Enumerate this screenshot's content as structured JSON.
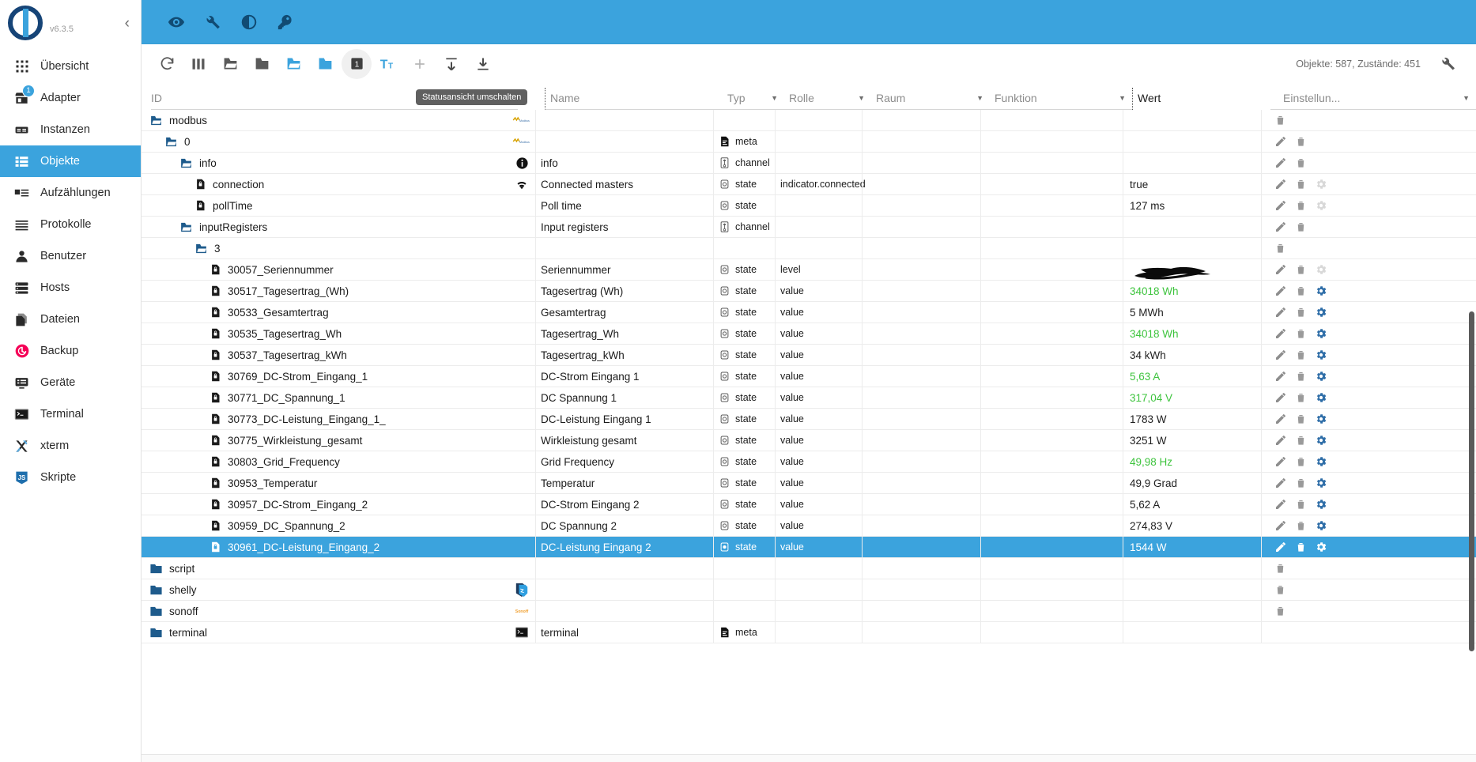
{
  "sidebar": {
    "version": "v6.3.5",
    "collapse_label": "‹",
    "items": [
      {
        "label": "Übersicht",
        "icon": "grid-icon",
        "active": false,
        "badge": null
      },
      {
        "label": "Adapter",
        "icon": "store-icon",
        "active": false,
        "badge": "1"
      },
      {
        "label": "Instanzen",
        "icon": "instances-icon",
        "active": false,
        "badge": null
      },
      {
        "label": "Objekte",
        "icon": "list-icon",
        "active": true,
        "badge": null
      },
      {
        "label": "Aufzählungen",
        "icon": "enums-icon",
        "active": false,
        "badge": null
      },
      {
        "label": "Protokolle",
        "icon": "logs-icon",
        "active": false,
        "badge": null
      },
      {
        "label": "Benutzer",
        "icon": "user-icon",
        "active": false,
        "badge": null
      },
      {
        "label": "Hosts",
        "icon": "hosts-icon",
        "active": false,
        "badge": null
      },
      {
        "label": "Dateien",
        "icon": "files-icon",
        "active": false,
        "badge": null
      },
      {
        "label": "Backup",
        "icon": "backup-icon",
        "active": false,
        "badge": null
      },
      {
        "label": "Geräte",
        "icon": "devices-icon",
        "active": false,
        "badge": null
      },
      {
        "label": "Terminal",
        "icon": "terminal-icon",
        "active": false,
        "badge": null
      },
      {
        "label": "xterm",
        "icon": "xterm-icon",
        "active": false,
        "badge": null
      },
      {
        "label": "Skripte",
        "icon": "javascript-icon",
        "active": false,
        "badge": null
      }
    ]
  },
  "appbar": {
    "buttons": [
      {
        "name": "eye-icon",
        "title": "Expertenmodus"
      },
      {
        "name": "wrench-icon",
        "title": "Konfiguration"
      },
      {
        "name": "contrast-icon",
        "title": "Theme"
      },
      {
        "name": "key-icon",
        "title": "Abmelden"
      }
    ]
  },
  "toolbar": {
    "buttons": [
      {
        "name": "refresh-icon"
      },
      {
        "name": "columns-icon"
      },
      {
        "name": "folder-expand-all-icon"
      },
      {
        "name": "folder-collapse-all-icon"
      },
      {
        "name": "folder-expand-icon"
      },
      {
        "name": "folder-collapse-icon"
      },
      {
        "name": "status-view-icon",
        "label": "1",
        "selected": true
      },
      {
        "name": "text-size-icon"
      },
      {
        "name": "add-icon"
      },
      {
        "name": "import-icon"
      },
      {
        "name": "export-icon"
      }
    ],
    "tooltip": "Statusansicht umschalten",
    "objects_count": "Objekte: 587, Zustände: 451",
    "settings_icon": "wrench-icon"
  },
  "table": {
    "columns": [
      {
        "key": "id",
        "label": "ID",
        "filter": false
      },
      {
        "key": "name",
        "label": "Name",
        "filter": false
      },
      {
        "key": "typ",
        "label": "Typ",
        "filter": true
      },
      {
        "key": "rolle",
        "label": "Rolle",
        "filter": true
      },
      {
        "key": "raum",
        "label": "Raum",
        "filter": true
      },
      {
        "key": "funktion",
        "label": "Funktion",
        "filter": true
      },
      {
        "key": "wert",
        "label": "Wert",
        "filter": false
      },
      {
        "key": "einstellungen",
        "label": "Einstellun...",
        "filter": true
      }
    ],
    "rows": [
      {
        "id": "modbus",
        "depth": 0,
        "icon": "folder-open-icon",
        "rowicon": "modbus-logo-icon",
        "name": "",
        "typ": "",
        "rolle": "",
        "wert": "",
        "value_color": "plain",
        "actions": [
          "delete"
        ],
        "selected": false
      },
      {
        "id": "0",
        "depth": 1,
        "icon": "folder-open-icon",
        "rowicon": "modbus-logo-icon",
        "name": "",
        "typ": "meta",
        "typicon": "meta-icon",
        "rolle": "",
        "wert": "",
        "value_color": "plain",
        "actions": [
          "edit",
          "delete"
        ],
        "selected": false
      },
      {
        "id": "info",
        "depth": 2,
        "icon": "folder-open-icon",
        "rowicon": "info-icon",
        "name": "info",
        "typ": "channel",
        "typicon": "channel-icon",
        "rolle": "",
        "wert": "",
        "value_color": "plain",
        "actions": [
          "edit",
          "delete"
        ],
        "selected": false
      },
      {
        "id": "connection",
        "depth": 3,
        "icon": "state-doc-icon",
        "rowicon": "wifi-icon",
        "name": "Connected masters",
        "typ": "state",
        "typicon": "state-icon",
        "rolle": "indicator.connected",
        "wert": "true",
        "value_color": "plain",
        "actions": [
          "edit",
          "delete",
          "settings-dim"
        ],
        "selected": false
      },
      {
        "id": "pollTime",
        "depth": 3,
        "icon": "state-doc-icon",
        "rowicon": "",
        "name": "Poll time",
        "typ": "state",
        "typicon": "state-icon",
        "rolle": "",
        "wert": "127 ms",
        "value_color": "plain",
        "actions": [
          "edit",
          "delete",
          "settings-dim"
        ],
        "selected": false
      },
      {
        "id": "inputRegisters",
        "depth": 2,
        "icon": "folder-open-icon",
        "rowicon": "",
        "name": "Input registers",
        "typ": "channel",
        "typicon": "channel-icon",
        "rolle": "",
        "wert": "",
        "value_color": "plain",
        "actions": [
          "edit",
          "delete"
        ],
        "selected": false
      },
      {
        "id": "3",
        "depth": 3,
        "icon": "folder-open-icon",
        "rowicon": "",
        "name": "",
        "typ": "",
        "rolle": "",
        "wert": "",
        "value_color": "plain",
        "actions": [
          "delete"
        ],
        "selected": false
      },
      {
        "id": "30057_Seriennummer",
        "depth": 4,
        "icon": "state-doc-icon",
        "rowicon": "",
        "name": "Seriennummer",
        "typ": "state",
        "typicon": "state-icon",
        "rolle": "level",
        "wert": "",
        "value_color": "redacted",
        "actions": [
          "edit",
          "delete",
          "settings-dim"
        ],
        "selected": false
      },
      {
        "id": "30517_Tagesertrag_(Wh)",
        "depth": 4,
        "icon": "state-doc-icon",
        "rowicon": "",
        "name": "Tagesertrag (Wh)",
        "typ": "state",
        "typicon": "state-icon",
        "rolle": "value",
        "wert": "34018 Wh",
        "value_color": "green",
        "actions": [
          "edit",
          "delete",
          "settings"
        ],
        "selected": false
      },
      {
        "id": "30533_Gesamtertrag",
        "depth": 4,
        "icon": "state-doc-icon",
        "rowicon": "",
        "name": "Gesamtertrag",
        "typ": "state",
        "typicon": "state-icon",
        "rolle": "value",
        "wert": "5 MWh",
        "value_color": "plain",
        "actions": [
          "edit",
          "delete",
          "settings"
        ],
        "selected": false
      },
      {
        "id": "30535_Tagesertrag_Wh",
        "depth": 4,
        "icon": "state-doc-icon",
        "rowicon": "",
        "name": "Tagesertrag_Wh",
        "typ": "state",
        "typicon": "state-icon",
        "rolle": "value",
        "wert": "34018 Wh",
        "value_color": "green",
        "actions": [
          "edit",
          "delete",
          "settings"
        ],
        "selected": false
      },
      {
        "id": "30537_Tagesertrag_kWh",
        "depth": 4,
        "icon": "state-doc-icon",
        "rowicon": "",
        "name": "Tagesertrag_kWh",
        "typ": "state",
        "typicon": "state-icon",
        "rolle": "value",
        "wert": "34 kWh",
        "value_color": "plain",
        "actions": [
          "edit",
          "delete",
          "settings"
        ],
        "selected": false
      },
      {
        "id": "30769_DC-Strom_Eingang_1",
        "depth": 4,
        "icon": "state-doc-icon",
        "rowicon": "",
        "name": "DC-Strom Eingang 1",
        "typ": "state",
        "typicon": "state-icon",
        "rolle": "value",
        "wert": "5,63 A",
        "value_color": "green",
        "actions": [
          "edit",
          "delete",
          "settings"
        ],
        "selected": false
      },
      {
        "id": "30771_DC_Spannung_1",
        "depth": 4,
        "icon": "state-doc-icon",
        "rowicon": "",
        "name": "DC Spannung 1",
        "typ": "state",
        "typicon": "state-icon",
        "rolle": "value",
        "wert": "317,04 V",
        "value_color": "green",
        "actions": [
          "edit",
          "delete",
          "settings"
        ],
        "selected": false
      },
      {
        "id": "30773_DC-Leistung_Eingang_1_",
        "depth": 4,
        "icon": "state-doc-icon",
        "rowicon": "",
        "name": "DC-Leistung Eingang 1",
        "typ": "state",
        "typicon": "state-icon",
        "rolle": "value",
        "wert": "1783 W",
        "value_color": "plain",
        "actions": [
          "edit",
          "delete",
          "settings"
        ],
        "selected": false
      },
      {
        "id": "30775_Wirkleistung_gesamt",
        "depth": 4,
        "icon": "state-doc-icon",
        "rowicon": "",
        "name": "Wirkleistung gesamt",
        "typ": "state",
        "typicon": "state-icon",
        "rolle": "value",
        "wert": "3251 W",
        "value_color": "plain",
        "actions": [
          "edit",
          "delete",
          "settings"
        ],
        "selected": false
      },
      {
        "id": "30803_Grid_Frequency",
        "depth": 4,
        "icon": "state-doc-icon",
        "rowicon": "",
        "name": "Grid Frequency",
        "typ": "state",
        "typicon": "state-icon",
        "rolle": "value",
        "wert": "49,98 Hz",
        "value_color": "green",
        "actions": [
          "edit",
          "delete",
          "settings"
        ],
        "selected": false
      },
      {
        "id": "30953_Temperatur",
        "depth": 4,
        "icon": "state-doc-icon",
        "rowicon": "",
        "name": "Temperatur",
        "typ": "state",
        "typicon": "state-icon",
        "rolle": "value",
        "wert": "49,9 Grad",
        "value_color": "plain",
        "actions": [
          "edit",
          "delete",
          "settings"
        ],
        "selected": false
      },
      {
        "id": "30957_DC-Strom_Eingang_2",
        "depth": 4,
        "icon": "state-doc-icon",
        "rowicon": "",
        "name": "DC-Strom Eingang 2",
        "typ": "state",
        "typicon": "state-icon",
        "rolle": "value",
        "wert": "5,62 A",
        "value_color": "plain",
        "actions": [
          "edit",
          "delete",
          "settings"
        ],
        "selected": false
      },
      {
        "id": "30959_DC_Spannung_2",
        "depth": 4,
        "icon": "state-doc-icon",
        "rowicon": "",
        "name": "DC Spannung 2",
        "typ": "state",
        "typicon": "state-icon",
        "rolle": "value",
        "wert": "274,83 V",
        "value_color": "plain",
        "actions": [
          "edit",
          "delete",
          "settings"
        ],
        "selected": false
      },
      {
        "id": "30961_DC-Leistung_Eingang_2",
        "depth": 4,
        "icon": "state-doc-icon",
        "rowicon": "",
        "name": "DC-Leistung Eingang 2",
        "typ": "state",
        "typicon": "state-icon",
        "rolle": "value",
        "wert": "1544 W",
        "value_color": "plain",
        "actions": [
          "edit",
          "delete",
          "settings"
        ],
        "selected": true
      },
      {
        "id": "script",
        "depth": 0,
        "icon": "folder-closed-icon",
        "rowicon": "",
        "name": "",
        "typ": "",
        "rolle": "",
        "wert": "",
        "value_color": "plain",
        "actions": [
          "delete"
        ],
        "selected": false
      },
      {
        "id": "shelly",
        "depth": 0,
        "icon": "folder-closed-icon",
        "rowicon": "shelly-logo-icon",
        "name": "",
        "typ": "",
        "rolle": "",
        "wert": "",
        "value_color": "plain",
        "actions": [
          "delete"
        ],
        "selected": false
      },
      {
        "id": "sonoff",
        "depth": 0,
        "icon": "folder-closed-icon",
        "rowicon": "sonoff-logo-icon",
        "name": "",
        "typ": "",
        "rolle": "",
        "wert": "",
        "value_color": "plain",
        "actions": [
          "delete"
        ],
        "selected": false
      },
      {
        "id": "terminal",
        "depth": 0,
        "icon": "folder-closed-icon",
        "rowicon": "terminal-logo-icon",
        "name": "terminal",
        "typ": "meta",
        "typicon": "meta-icon",
        "rolle": "",
        "wert": "",
        "value_color": "plain",
        "actions": [],
        "selected": false
      }
    ]
  },
  "colors": {
    "accent": "#3ba3dd",
    "value_green": "#3ec43e",
    "selected_row": "#3ba3dd",
    "folder_blue": "#1e5b8c",
    "badge_blue": "#3ba3dd"
  }
}
